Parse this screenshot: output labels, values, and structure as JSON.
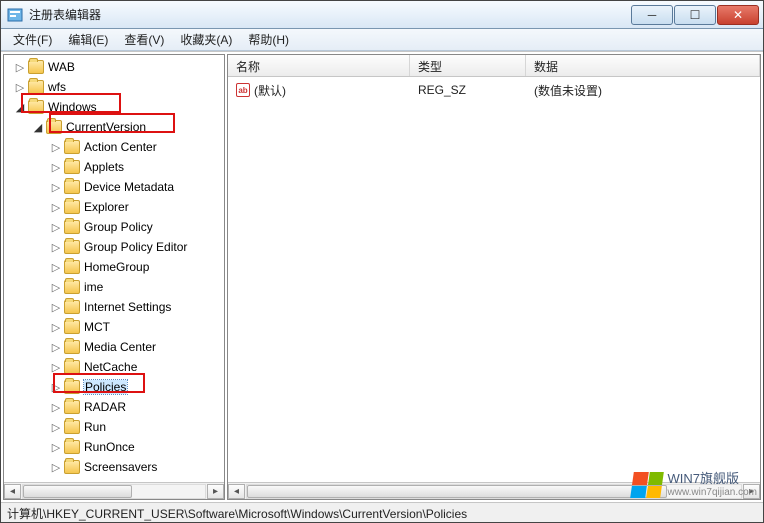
{
  "window": {
    "title": "注册表编辑器"
  },
  "menu": {
    "file": "文件(F)",
    "edit": "编辑(E)",
    "view": "查看(V)",
    "favorites": "收藏夹(A)",
    "help": "帮助(H)"
  },
  "tree": {
    "wab": "WAB",
    "wfs": "wfs",
    "windows": "Windows",
    "currentversion": "CurrentVersion",
    "children": {
      "action_center": "Action Center",
      "applets": "Applets",
      "device_metadata": "Device Metadata",
      "explorer": "Explorer",
      "group_policy": "Group Policy",
      "group_policy_editor": "Group Policy Editor",
      "homegroup": "HomeGroup",
      "ime": "ime",
      "internet_settings": "Internet Settings",
      "mct": "MCT",
      "media_center": "Media Center",
      "netcache": "NetCache",
      "policies": "Policies",
      "radar": "RADAR",
      "run": "Run",
      "runonce": "RunOnce",
      "screensavers": "Screensavers"
    }
  },
  "list": {
    "col_name": "名称",
    "col_type": "类型",
    "col_data": "数据",
    "row": {
      "name": "(默认)",
      "type": "REG_SZ",
      "data": "(数值未设置)"
    }
  },
  "status": {
    "path": "计算机\\HKEY_CURRENT_USER\\Software\\Microsoft\\Windows\\CurrentVersion\\Policies"
  },
  "watermark": {
    "label": "WIN7旗舰版",
    "url": "www.win7qijian.com"
  }
}
